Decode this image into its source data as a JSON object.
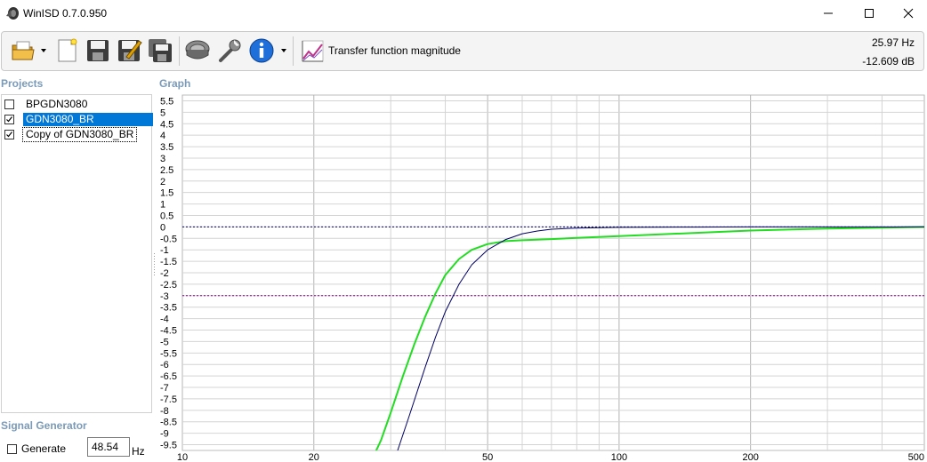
{
  "window": {
    "title": "WinISD 0.7.0.950",
    "icon": "speaker-icon"
  },
  "toolbar": {
    "buttons": [
      "open-project-icon",
      "new-project-icon",
      "save-icon",
      "save-as-icon",
      "save-all-icon",
      "driver-editor-icon",
      "options-wrench-icon",
      "about-info-icon"
    ],
    "graph_type_icon": "graph-icon",
    "graph_type_label": "Transfer function magnitude",
    "cursor_freq": "25.97 Hz",
    "cursor_value": "-12.609 dB"
  },
  "projects": {
    "label": "Projects",
    "items": [
      {
        "name": "BPGDN3080",
        "checked": false,
        "selected": false
      },
      {
        "name": "GDN3080_BR",
        "checked": true,
        "selected": true
      },
      {
        "name": "Copy of GDN3080_BR",
        "checked": true,
        "selected": false
      }
    ]
  },
  "graph": {
    "label": "Graph"
  },
  "signal_generator": {
    "label": "Signal Generator",
    "generate_label": "Generate",
    "generate_checked": false,
    "frequency": "48.54",
    "unit": "Hz"
  },
  "colors": {
    "selection": "#0078d7",
    "green_curve": "#22dd22",
    "navy_curve": "#000066",
    "zero_line": "#000066",
    "minus3_line": "#800080",
    "section_label": "#7a9ab8"
  },
  "chart_data": {
    "type": "line",
    "xscale": "log",
    "xlim": [
      10,
      500
    ],
    "ylim": [
      -9.75,
      5.75
    ],
    "x_ticks": [
      "10",
      "20",
      "50",
      "100",
      "200",
      "500"
    ],
    "y_ticks": [
      "5.5",
      "5",
      "4.5",
      "4",
      "3.5",
      "3",
      "2.5",
      "2",
      "1.5",
      "1",
      "0.5",
      "0",
      "-0.5",
      "-1",
      "-1.5",
      "-2",
      "-2.5",
      "-3",
      "-3.5",
      "-4",
      "-4.5",
      "-5",
      "-5.5",
      "-6",
      "-6.5",
      "-7",
      "-7.5",
      "-8",
      "-8.5",
      "-9",
      "-9.5"
    ],
    "reference_lines": [
      {
        "y": 0,
        "color": "#000066",
        "style": "dotted"
      },
      {
        "y": -3,
        "color": "#800080",
        "style": "dotted"
      }
    ],
    "series": [
      {
        "color": "#22dd22",
        "width": 2,
        "x": [
          27.4,
          28.5,
          30,
          32,
          34,
          36,
          38,
          40,
          43,
          46,
          50,
          55,
          60,
          70,
          80,
          100,
          150,
          200,
          300,
          400,
          500
        ],
        "y": [
          -10,
          -9.3,
          -8.1,
          -6.5,
          -5.1,
          -3.9,
          -2.9,
          -2.1,
          -1.4,
          -1.0,
          -0.75,
          -0.62,
          -0.58,
          -0.53,
          -0.48,
          -0.4,
          -0.26,
          -0.16,
          -0.07,
          -0.03,
          0
        ]
      },
      {
        "color": "#000066",
        "width": 1,
        "x": [
          30.8,
          33,
          36,
          38,
          40,
          43,
          46,
          50,
          55,
          60,
          65,
          70,
          80,
          100,
          150,
          200,
          300,
          500
        ],
        "y": [
          -10,
          -8.3,
          -6.1,
          -4.8,
          -3.7,
          -2.5,
          -1.65,
          -1.0,
          -0.55,
          -0.3,
          -0.18,
          -0.1,
          -0.05,
          -0.02,
          -0.01,
          0,
          0,
          0
        ]
      }
    ]
  }
}
